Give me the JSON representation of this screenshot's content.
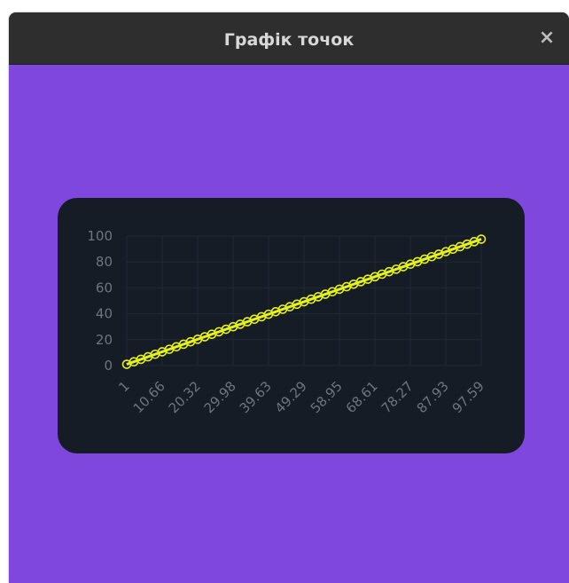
{
  "window": {
    "title": "Графік точок",
    "close_glyph": "×"
  },
  "colors": {
    "window_bg": "#8047de",
    "titlebar_bg": "#2e2e2e",
    "card_bg": "#161c26",
    "series_color": "#e6f21c",
    "tick_color": "#6e747c",
    "grid_color": "#202834"
  },
  "chart_data": {
    "type": "line",
    "title": "",
    "xlabel": "",
    "ylabel": "",
    "grid": true,
    "legend": "none",
    "x_start": 1,
    "x_end": 97.59,
    "point_count": 51,
    "ylim": [
      0,
      100
    ],
    "y_ticks": [
      0,
      20,
      40,
      60,
      80,
      100
    ],
    "x_tick_labels": [
      "1",
      "10.66",
      "20.32",
      "29.98",
      "39.63",
      "49.29",
      "58.95",
      "68.61",
      "78.27",
      "87.93",
      "97.59"
    ],
    "series": [
      {
        "marker": "circle"
      }
    ]
  }
}
